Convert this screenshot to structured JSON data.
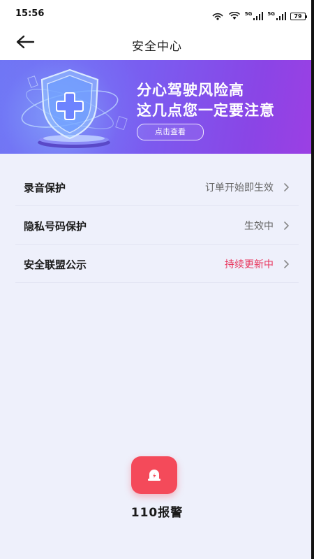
{
  "status_bar": {
    "time": "15:56",
    "network_1": "5G",
    "network_2": "5G",
    "battery": "79"
  },
  "header": {
    "title": "安全中心",
    "back_icon": "arrow-left-icon"
  },
  "banner": {
    "headline_1": "分心驾驶风险高",
    "headline_2": "这几点您一定要注意",
    "button_label": "点击查看",
    "icon": "shield-plus-icon",
    "colors": {
      "gradient_start": "#6f74f4",
      "gradient_end": "#9c3fe3"
    }
  },
  "settings": {
    "items": [
      {
        "label": "录音保护",
        "value": "订单开始即生效",
        "icon": "chevron-right-icon"
      },
      {
        "label": "隐私号码保护",
        "value": "生效中",
        "icon": "chevron-right-icon"
      },
      {
        "label": "安全联盟公示",
        "value": "持续更新中",
        "icon": "chevron-right-icon",
        "value_color": "#e8355c"
      }
    ]
  },
  "emergency": {
    "label": "110报警",
    "icon": "alarm-light-icon",
    "color": "#f44a5a"
  }
}
